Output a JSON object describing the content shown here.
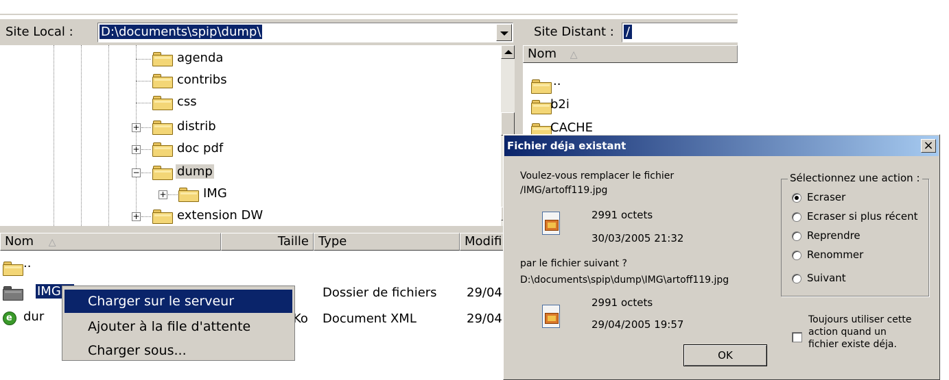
{
  "local": {
    "label": "Site Local :",
    "path": "D:\\documents\\spip\\dump\\",
    "tree": [
      {
        "name": "agenda"
      },
      {
        "name": "contribs"
      },
      {
        "name": "css"
      },
      {
        "name": "distrib",
        "toggle": "+"
      },
      {
        "name": "doc pdf",
        "toggle": "+"
      },
      {
        "name": "dump",
        "toggle": "−"
      },
      {
        "name": "IMG",
        "toggle": "+"
      },
      {
        "name": "extension DW",
        "toggle": "+"
      }
    ],
    "columns": {
      "name": "Nom",
      "size": "Taille",
      "type": "Type",
      "modified": "Modifi"
    },
    "files": [
      {
        "name": ".."
      },
      {
        "name": "IMG",
        "type": "Dossier de fichiers",
        "modified": "29/04,"
      },
      {
        "name": "dur",
        "size": "Ko",
        "type": "Document XML",
        "modified": "29/04,"
      }
    ]
  },
  "remote": {
    "label": "Site Distant :",
    "path": "/",
    "column": "Nom",
    "files": [
      {
        "name": ".."
      },
      {
        "name": "b2i"
      },
      {
        "name": "CACHE"
      }
    ]
  },
  "context_menu": [
    "Charger sur le serveur",
    "Ajouter à la file d'attente",
    "Charger sous..."
  ],
  "dialog": {
    "title": "Fichier déja existant",
    "question1": "Voulez-vous remplacer le fichier",
    "file1_path": "/IMG/artoff119.jpg",
    "file1_size": "2991 octets",
    "file1_date": "30/03/2005 21:32",
    "question2": "par le fichier suivant ?",
    "file2_path": "D:\\documents\\spip\\dump\\IMG\\artoff119.jpg",
    "file2_size": "2991 octets",
    "file2_date": "29/04/2005 19:57",
    "ok_label": "OK",
    "group_label": "Sélectionnez une action :",
    "actions": [
      "Ecraser",
      "Ecraser si plus récent",
      "Reprendre",
      "Renommer",
      "Suivant"
    ],
    "selected_action": "Ecraser",
    "checkbox_line1": "Toujours utiliser cette",
    "checkbox_line2": "action quand un",
    "checkbox_line3": "fichier existe déja.",
    "close_symbol": "×"
  },
  "colors": {
    "selection": "#0a246a",
    "face": "#d4d0c8",
    "title_start": "#0a246a",
    "title_end": "#a6caf0"
  }
}
